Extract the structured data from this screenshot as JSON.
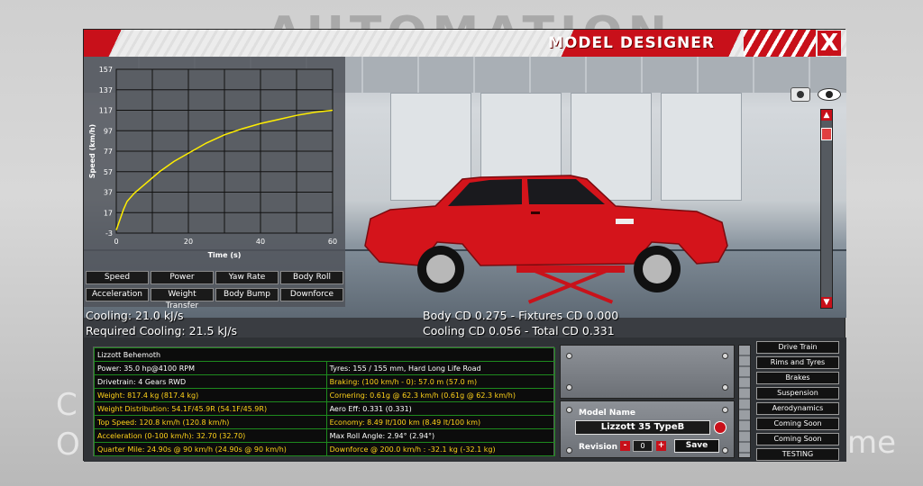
{
  "background": {
    "brand_text": "AUTOMATION",
    "left_text_1": "C",
    "left_text_2": "O",
    "right_text": "me"
  },
  "window": {
    "title": "MODEL DESIGNER",
    "close_label": "X"
  },
  "graph": {
    "xlabel": "Time (s)",
    "ylabel": "Speed (km/h)",
    "x_ticks": [
      "0",
      "20",
      "40",
      "60"
    ],
    "y_ticks": [
      "157",
      "137",
      "117",
      "97",
      "77",
      "57",
      "37",
      "17",
      "-3"
    ]
  },
  "chart_data": {
    "type": "line",
    "xlabel": "Time (s)",
    "ylabel": "Speed (km/h)",
    "xlim": [
      0,
      60
    ],
    "ylim": [
      -3,
      157
    ],
    "grid": true,
    "series": [
      {
        "x": [
          0,
          1,
          2,
          3,
          5,
          8,
          12,
          16,
          20,
          25,
          30,
          35,
          40,
          45,
          50,
          55,
          60
        ],
        "values": [
          0,
          10,
          20,
          28,
          36,
          45,
          57,
          67,
          75,
          85,
          93,
          99,
          104,
          108,
          112,
          115,
          117
        ]
      }
    ],
    "colors": [
      "#ffee00"
    ]
  },
  "graph_buttons": [
    "Speed",
    "Power",
    "Yaw Rate",
    "Body Roll",
    "Acceleration",
    "Weight Transfer",
    "Body Bump",
    "Downforce"
  ],
  "info": {
    "cooling": "Cooling: 21.0 kJ/s",
    "required_cooling": "Required Cooling: 21.5 kJ/s",
    "body_cd": "Body CD 0.275 - Fixtures CD 0.000",
    "cooling_cd": "Cooling CD 0.056 - Total CD 0.331"
  },
  "stats": {
    "name": "Lizzott Behemoth",
    "rows": [
      [
        "Power: 35.0 hp@4100 RPM",
        "Tyres: 155 / 155 mm, Hard Long Life Road"
      ],
      [
        "Drivetrain: 4 Gears RWD",
        "Braking: (100 km/h - 0): 57.0 m (57.0 m)"
      ],
      [
        "Weight: 817.4 kg (817.4 kg)",
        "Cornering: 0.61g @ 62.3 km/h (0.61g @ 62.3 km/h)"
      ],
      [
        "Weight Distribution: 54.1F/45.9R (54.1F/45.9R)",
        "Aero Eff: 0.331 (0.331)"
      ],
      [
        "Top Speed: 120.8 km/h (120.8 km/h)",
        "Economy: 8.49 lt/100 km (8.49 lt/100 km)"
      ],
      [
        "Acceleration (0-100 km/h): 32.70 (32.70)",
        "Max Roll Angle: 2.94° (2.94°)"
      ],
      [
        "Quarter Mile: 24.90s @ 90 km/h (24.90s @ 90 km/h)",
        "Downforce @ 200.0 km/h : -32.1 kg (-32.1 kg)"
      ]
    ]
  },
  "model": {
    "name_label": "Model Name",
    "name_value": "Lizzott 35 TypeB",
    "revision_label": "Revision",
    "revision_value": "0",
    "minus": "-",
    "plus": "+",
    "save_label": "Save"
  },
  "nav": [
    "Drive Train",
    "Rims and Tyres",
    "Brakes",
    "Suspension",
    "Aerodynamics",
    "Coming Soon",
    "Coming Soon",
    "TESTING"
  ],
  "scroll": {
    "up": "▲",
    "down": "▼"
  },
  "colors": {
    "accent": "#c8101a",
    "curve": "#ffee00",
    "stat_highlight": "#ffd21a",
    "grid_border": "#1e8a1e"
  }
}
